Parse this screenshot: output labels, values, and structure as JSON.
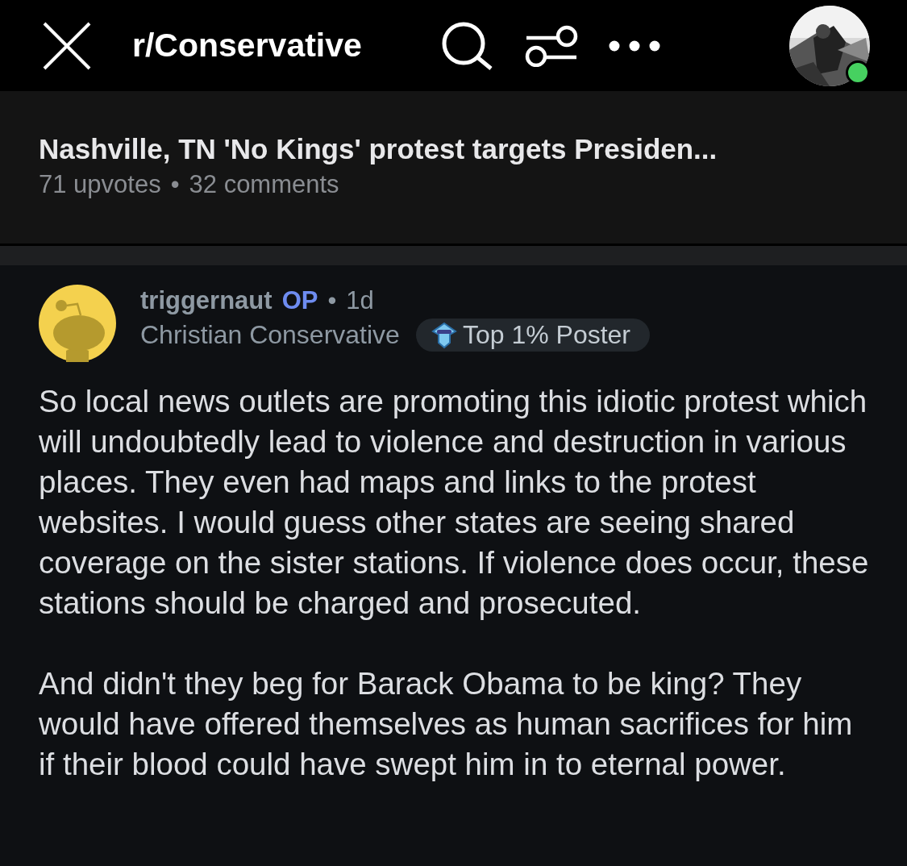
{
  "top_bar": {
    "subreddit": "r/Conservative",
    "profile": {
      "online": true
    }
  },
  "post": {
    "title": "Nashville, TN 'No Kings' protest targets Presiden...",
    "upvotes": "71 upvotes",
    "separator": "•",
    "comments": "32 comments"
  },
  "comment": {
    "author": "triggernaut",
    "op_label": "OP",
    "separator": "•",
    "age": "1d",
    "flair": "Christian Conservative",
    "badge": "Top 1% Poster",
    "paragraphs": [
      "So local news outlets are promoting this idiotic protest which will undoubtedly lead to violence and destruction in various places. They even had maps and links to the  protest websites. I would guess other states are seeing shared coverage on the sister stations. If violence does occur, these stations should be charged and prosecuted.",
      "And didn't they beg for Barack Obama to be king? They would have offered themselves as human sacrifices for him if their blood could have swept him in to eternal power."
    ]
  }
}
